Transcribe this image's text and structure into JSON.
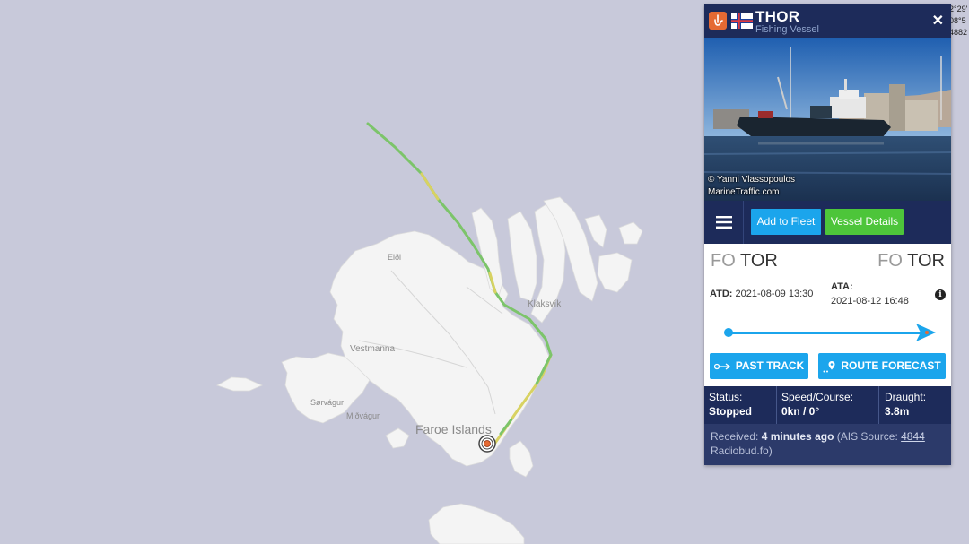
{
  "map": {
    "labels": {
      "country": "Faroe Islands",
      "vestmanna": "Vestmanna",
      "klaksvik": "Klaksvík",
      "eidi": "Eiði",
      "sorvagur": "Sørvágur",
      "midvagur": "Miðvágur"
    },
    "coords_partial": [
      "2°29'",
      "08°5",
      "4882"
    ],
    "colors": {
      "sea": "#c8c9da",
      "land": "#f4f4f4",
      "track_green": "#7cc46a",
      "track_yellow": "#d8d262",
      "vessel_marker": "#e56a33"
    }
  },
  "vessel": {
    "name": "THOR",
    "type": "Fishing Vessel",
    "flag_icon": "faroe-islands-flag-icon",
    "photo_credit_line1": "© Yanni Vlassopoulos",
    "photo_credit_line2": "MarineTraffic.com",
    "buttons": {
      "add_to_fleet": "Add to Fleet",
      "vessel_details": "Vessel Details"
    },
    "departure": {
      "country": "FO",
      "port": "TOR"
    },
    "arrival": {
      "country": "FO",
      "port": "TOR"
    },
    "atd_label": "ATD:",
    "atd_value": "2021-08-09 13:30",
    "ata_label": "ATA:",
    "ata_value": "2021-08-12 16:48",
    "voyage_progress": 1.0,
    "past_track_label": "PAST TRACK",
    "route_forecast_label": "ROUTE FORECAST",
    "status": {
      "status_label": "Status:",
      "status_value": "Stopped",
      "speed_label": "Speed/Course:",
      "speed_value": "0kn / 0°",
      "draught_label": "Draught:",
      "draught_value": "3.8m"
    },
    "received": {
      "prefix": "Received:",
      "age": "4 minutes ago",
      "ais_prefix": "(AIS Source:",
      "ais_id": "4844",
      "ais_name": "Radiobud.fo)"
    },
    "colors": {
      "header_navy": "#1d2b5a",
      "accent_blue": "#1ba5ec",
      "accent_green": "#4dc53a",
      "vessel_icon_orange": "#e56a33"
    }
  }
}
